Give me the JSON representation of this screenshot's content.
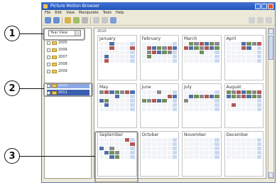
{
  "callouts": [
    "1",
    "2",
    "3"
  ],
  "window": {
    "title": "Picture Motion Browser",
    "menu": [
      "File",
      "Edit",
      "View",
      "Manipulate",
      "Tools",
      "Help"
    ]
  },
  "left_pane": {
    "mode_value": "Year View",
    "folders": [
      {
        "label": "2005",
        "state": "normal"
      },
      {
        "label": "2006",
        "state": "normal"
      },
      {
        "label": "2007",
        "state": "normal"
      },
      {
        "label": "2008",
        "state": "normal"
      },
      {
        "label": "2009",
        "state": "normal"
      },
      {
        "label": "2010",
        "state": "selected"
      },
      {
        "label": "2011",
        "state": "active"
      }
    ]
  },
  "calendar": {
    "year_label": "2010",
    "months": [
      "January",
      "February",
      "March",
      "April",
      "May",
      "June",
      "July",
      "August",
      "September",
      "October",
      "November",
      "December"
    ]
  }
}
